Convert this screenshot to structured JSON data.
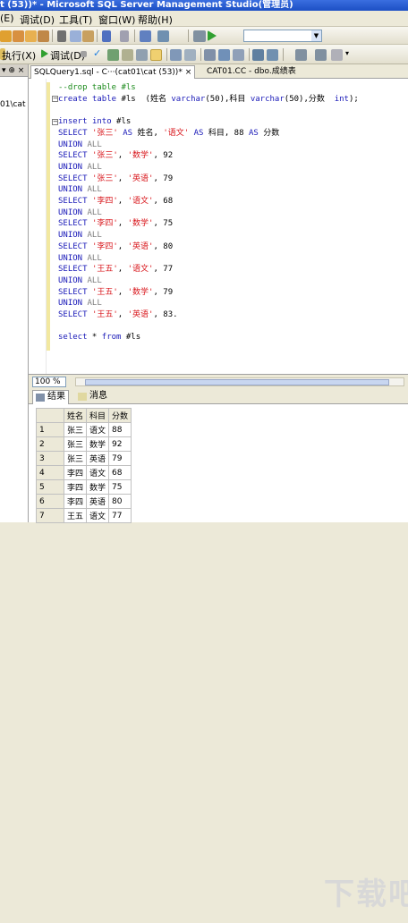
{
  "window": {
    "title": "t (53))* - Microsoft SQL Server Management Studio(管理员)"
  },
  "menu": [
    "(E)",
    "调试(D)",
    "工具(T)",
    "窗口(W)",
    "帮助(H)"
  ],
  "toolbar": {
    "execute_label": "执行(X)",
    "debug_label": "调试(D)"
  },
  "object_explorer": {
    "item": "01\\cat"
  },
  "tabs": [
    {
      "label": "SQLQuery1.sql - C···(cat01\\cat (53))*",
      "close": "×"
    },
    {
      "label": "CAT01.CC - dbo.成绩表"
    }
  ],
  "editor": {
    "lines": [
      [
        {
          "t": "--drop table #ls",
          "c": "cm"
        }
      ],
      [
        {
          "t": "create",
          "c": "kw"
        },
        {
          "t": " "
        },
        {
          "t": "table",
          "c": "kw"
        },
        {
          "t": " #ls  (姓名 "
        },
        {
          "t": "varchar",
          "c": "kw"
        },
        {
          "t": "(50),科目 "
        },
        {
          "t": "varchar",
          "c": "kw"
        },
        {
          "t": "(50),分数  "
        },
        {
          "t": "int",
          "c": "kw"
        },
        {
          "t": ");"
        }
      ],
      [
        {
          "t": ""
        }
      ],
      [
        {
          "t": "insert",
          "c": "kw"
        },
        {
          "t": " "
        },
        {
          "t": "into",
          "c": "kw"
        },
        {
          "t": " #ls"
        }
      ],
      [
        {
          "t": "SELECT",
          "c": "kw"
        },
        {
          "t": " "
        },
        {
          "t": "'张三'",
          "c": "str"
        },
        {
          "t": " "
        },
        {
          "t": "AS",
          "c": "kw"
        },
        {
          "t": " 姓名, "
        },
        {
          "t": "'语文'",
          "c": "str"
        },
        {
          "t": " "
        },
        {
          "t": "AS",
          "c": "kw"
        },
        {
          "t": " 科目, 88 "
        },
        {
          "t": "AS",
          "c": "kw"
        },
        {
          "t": " 分数"
        }
      ],
      [
        {
          "t": "UNION",
          "c": "kw"
        },
        {
          "t": " "
        },
        {
          "t": "ALL",
          "c": "gr"
        }
      ],
      [
        {
          "t": "SELECT",
          "c": "kw"
        },
        {
          "t": " "
        },
        {
          "t": "'张三'",
          "c": "str"
        },
        {
          "t": ", "
        },
        {
          "t": "'数学'",
          "c": "str"
        },
        {
          "t": ", 92"
        }
      ],
      [
        {
          "t": "UNION",
          "c": "kw"
        },
        {
          "t": " "
        },
        {
          "t": "ALL",
          "c": "gr"
        }
      ],
      [
        {
          "t": "SELECT",
          "c": "kw"
        },
        {
          "t": " "
        },
        {
          "t": "'张三'",
          "c": "str"
        },
        {
          "t": ", "
        },
        {
          "t": "'英语'",
          "c": "str"
        },
        {
          "t": ", 79"
        }
      ],
      [
        {
          "t": "UNION",
          "c": "kw"
        },
        {
          "t": " "
        },
        {
          "t": "ALL",
          "c": "gr"
        }
      ],
      [
        {
          "t": "SELECT",
          "c": "kw"
        },
        {
          "t": " "
        },
        {
          "t": "'李四'",
          "c": "str"
        },
        {
          "t": ", "
        },
        {
          "t": "'语文'",
          "c": "str"
        },
        {
          "t": ", 68"
        }
      ],
      [
        {
          "t": "UNION",
          "c": "kw"
        },
        {
          "t": " "
        },
        {
          "t": "ALL",
          "c": "gr"
        }
      ],
      [
        {
          "t": "SELECT",
          "c": "kw"
        },
        {
          "t": " "
        },
        {
          "t": "'李四'",
          "c": "str"
        },
        {
          "t": ", "
        },
        {
          "t": "'数学'",
          "c": "str"
        },
        {
          "t": ", 75"
        }
      ],
      [
        {
          "t": "UNION",
          "c": "kw"
        },
        {
          "t": " "
        },
        {
          "t": "ALL",
          "c": "gr"
        }
      ],
      [
        {
          "t": "SELECT",
          "c": "kw"
        },
        {
          "t": " "
        },
        {
          "t": "'李四'",
          "c": "str"
        },
        {
          "t": ", "
        },
        {
          "t": "'英语'",
          "c": "str"
        },
        {
          "t": ", 80"
        }
      ],
      [
        {
          "t": "UNION",
          "c": "kw"
        },
        {
          "t": " "
        },
        {
          "t": "ALL",
          "c": "gr"
        }
      ],
      [
        {
          "t": "SELECT",
          "c": "kw"
        },
        {
          "t": " "
        },
        {
          "t": "'王五'",
          "c": "str"
        },
        {
          "t": ", "
        },
        {
          "t": "'语文'",
          "c": "str"
        },
        {
          "t": ", 77"
        }
      ],
      [
        {
          "t": "UNION",
          "c": "kw"
        },
        {
          "t": " "
        },
        {
          "t": "ALL",
          "c": "gr"
        }
      ],
      [
        {
          "t": "SELECT",
          "c": "kw"
        },
        {
          "t": " "
        },
        {
          "t": "'王五'",
          "c": "str"
        },
        {
          "t": ", "
        },
        {
          "t": "'数学'",
          "c": "str"
        },
        {
          "t": ", 79"
        }
      ],
      [
        {
          "t": "UNION",
          "c": "kw"
        },
        {
          "t": " "
        },
        {
          "t": "ALL",
          "c": "gr"
        }
      ],
      [
        {
          "t": "SELECT",
          "c": "kw"
        },
        {
          "t": " "
        },
        {
          "t": "'王五'",
          "c": "str"
        },
        {
          "t": ", "
        },
        {
          "t": "'英语'",
          "c": "str"
        },
        {
          "t": ", 83."
        }
      ],
      [
        {
          "t": ""
        }
      ],
      [
        {
          "t": "select",
          "c": "kw"
        },
        {
          "t": " * "
        },
        {
          "t": "from",
          "c": "kw"
        },
        {
          "t": " #ls"
        }
      ]
    ]
  },
  "zoom": "100 %",
  "results": {
    "tabs": [
      {
        "label": "结果"
      },
      {
        "label": "消息"
      }
    ],
    "columns": [
      "姓名",
      "科目",
      "分数"
    ],
    "rows": [
      [
        "1",
        "张三",
        "语文",
        "88"
      ],
      [
        "2",
        "张三",
        "数学",
        "92"
      ],
      [
        "3",
        "张三",
        "英语",
        "79"
      ],
      [
        "4",
        "李四",
        "语文",
        "68"
      ],
      [
        "5",
        "李四",
        "数学",
        "75"
      ],
      [
        "6",
        "李四",
        "英语",
        "80"
      ],
      [
        "7",
        "王五",
        "语文",
        "77"
      ]
    ]
  },
  "colors": {
    "keyword": "#1a1ab8",
    "string": "#d8141a",
    "comment": "#1a8a1a",
    "title_bar": "#1c4fc4"
  }
}
